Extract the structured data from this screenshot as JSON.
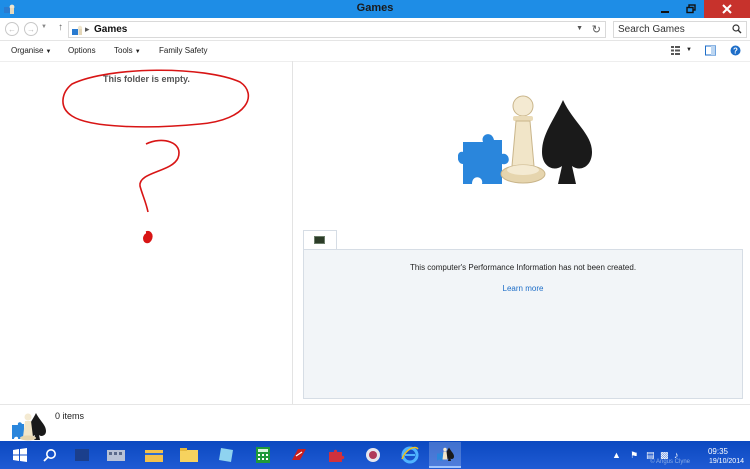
{
  "window": {
    "title": "Games",
    "minimize_icon": "minimize-icon",
    "maximize_icon": "restore-icon",
    "close_icon": "close-icon",
    "accent": "#1e8de6",
    "close_color": "#c7322c"
  },
  "address": {
    "breadcrumb": "Games",
    "search_placeholder": "Search Games"
  },
  "toolbar": {
    "organise": "Organise",
    "options": "Options",
    "tools": "Tools",
    "family_safety": "Family Safety"
  },
  "left_pane": {
    "empty_message": "This folder is empty."
  },
  "right_pane": {
    "wei_message": "This computer's Performance Information has not been created.",
    "wei_link": "Learn more",
    "link_color": "#1e6ec8"
  },
  "details_pane": {
    "item_count": "0 items"
  },
  "taskbar": {
    "time": "09:35",
    "date": "19/10/2014",
    "watermark": "© Angus Clyne",
    "color": "#1f5bd4"
  }
}
